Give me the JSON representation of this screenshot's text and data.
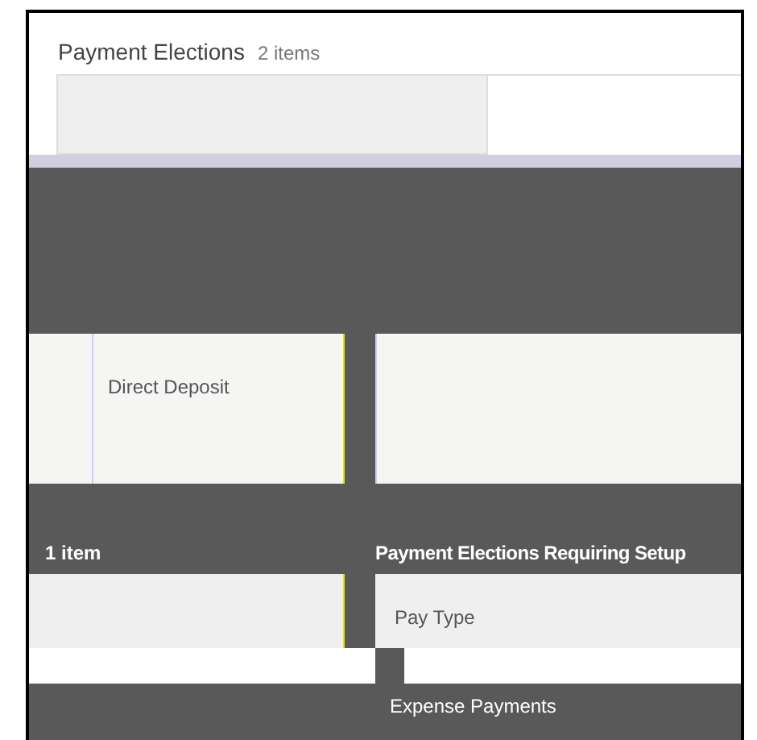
{
  "section": {
    "title": "Payment Elections",
    "count": "2 items"
  },
  "election_row": {
    "payment_type": "Direct Deposit"
  },
  "left_section": {
    "count": "1 item"
  },
  "setup_section": {
    "title": "Payment Elections Requiring Setup",
    "column": "Pay Type",
    "row": "Expense Payments"
  }
}
